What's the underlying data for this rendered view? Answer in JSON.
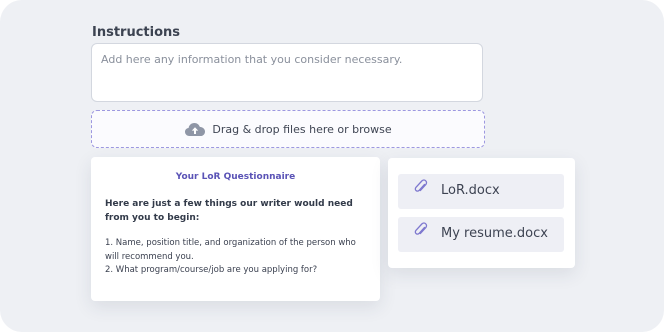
{
  "form": {
    "instructions_label": "Instructions",
    "instructions_placeholder": "Add here any information that you consider necessary.",
    "dropzone_text": "Drag & drop files here or browse"
  },
  "questionnaire": {
    "title": "Your LoR Questionnaire",
    "intro": "Here are just a few things our writer would need from you to begin:",
    "items": [
      "1. Name, position title, and organization of the person who will recommend you.",
      "2. What program/course/job are you applying for?"
    ]
  },
  "files": [
    {
      "name": "LoR.docx",
      "icon": "paperclip-icon"
    },
    {
      "name": "My resume.docx",
      "icon": "paperclip-icon"
    }
  ],
  "colors": {
    "accent": "#5a53b6",
    "dropzone_border": "#9d98e0",
    "background": "#eef0f4"
  }
}
